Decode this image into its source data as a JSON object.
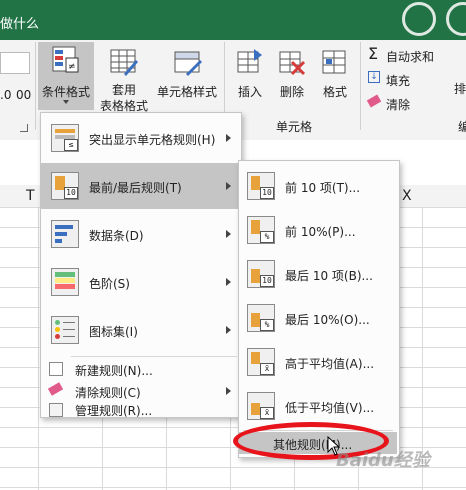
{
  "titlebar": {
    "tell_me": "做什么"
  },
  "ribbon": {
    "conditional_format": "条件格式",
    "apply_table_line1": "套用",
    "apply_table_line2": "表格格式",
    "cell_styles": "单元格样式",
    "insert": "插入",
    "delete": "删除",
    "format": "格式",
    "cells_group": "单元格",
    "autosum": "自动求和",
    "fill": "填充",
    "clear": "清除",
    "sort_partial": "排",
    "num_partial_1": ".0",
    "num_partial_2": "00",
    "group_partial": "编"
  },
  "columns": {
    "t": "T",
    "x": "X"
  },
  "main_menu": {
    "items": [
      {
        "label": "突出显示单元格规则(H)",
        "icon": "highlight-cells-icon"
      },
      {
        "label": "最前/最后规则(T)",
        "icon": "top-bottom-icon"
      },
      {
        "label": "数据条(D)",
        "icon": "data-bars-icon"
      },
      {
        "label": "色阶(S)",
        "icon": "color-scales-icon"
      },
      {
        "label": "图标集(I)",
        "icon": "icon-sets-icon"
      }
    ],
    "small_items": [
      {
        "label": "新建规则(N)...",
        "icon": "new-rule-icon"
      },
      {
        "label": "清除规则(C)",
        "icon": "clear-rules-icon"
      },
      {
        "label": "管理规则(R)...",
        "icon": "manage-rules-icon"
      }
    ]
  },
  "sub_menu": {
    "items": [
      {
        "label": "前 10 项(T)...",
        "tag": "10"
      },
      {
        "label": "前 10%(P)...",
        "tag": "%"
      },
      {
        "label": "最后 10 项(B)...",
        "tag": "10"
      },
      {
        "label": "最后 10%(O)...",
        "tag": "%"
      },
      {
        "label": "高于平均值(A)...",
        "tag": "x̄"
      },
      {
        "label": "低于平均值(V)...",
        "tag": "x̄"
      }
    ],
    "more_rules": "其他规则(M)..."
  },
  "watermark": "Baidu经验",
  "colors": {
    "excel_green": "#217346",
    "highlight": "#c5c5c5",
    "annotation_red": "#e8141b"
  }
}
